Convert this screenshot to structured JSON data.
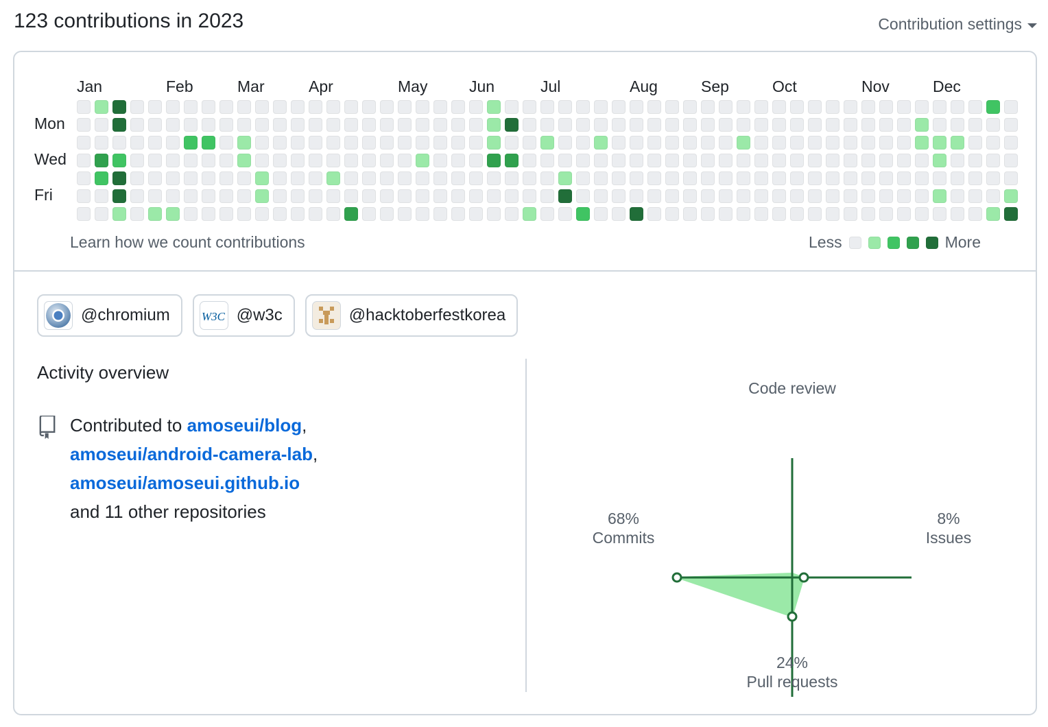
{
  "header": {
    "title": "123 contributions in 2023",
    "settings_label": "Contribution settings"
  },
  "calendar": {
    "months": [
      "Jan",
      "Feb",
      "Mar",
      "Apr",
      "May",
      "Jun",
      "Jul",
      "Aug",
      "Sep",
      "Oct",
      "Nov",
      "Dec"
    ],
    "day_labels": [
      "Mon",
      "Wed",
      "Fri"
    ],
    "learn_link": "Learn how we count contributions",
    "legend_less": "Less",
    "legend_more": "More",
    "colors": [
      "#ebedf0",
      "#9be9a8",
      "#40c463",
      "#30a14e",
      "#216e39"
    ],
    "contribution_levels": {
      "week_1": {
        "Sat": 0
      },
      "week_2": {
        "Sun": 1,
        "Wed": 3,
        "Thu": 2
      },
      "week_3": {
        "Sun": 4,
        "Mon": 4,
        "Wed": 2,
        "Thu": 4,
        "Fri": 4,
        "Sat": 1
      },
      "week_4": {},
      "week_5": {
        "Sat": 1
      },
      "week_6": {
        "Sat": 1
      },
      "week_7": {
        "Tue": 2
      },
      "week_8": {
        "Tue": 2
      },
      "week_10": {
        "Tue": 1,
        "Wed": 1
      },
      "week_11": {
        "Thu": 1,
        "Fri": 1
      },
      "week_15": {
        "Thu": 1
      },
      "week_16": {
        "Sat": 3
      },
      "week_20": {
        "Wed": 1
      },
      "week_24": {
        "Sun": 1,
        "Mon": 1,
        "Tue": 1,
        "Wed": 3
      },
      "week_25": {
        "Mon": 4,
        "Wed": 3
      },
      "week_26": {
        "Sat": 1
      },
      "week_27": {
        "Tue": 1
      },
      "week_28": {
        "Thu": 1,
        "Fri": 4
      },
      "week_29": {
        "Sat": 2
      },
      "week_30": {
        "Tue": 1
      },
      "week_32": {
        "Sat": 4
      },
      "week_38": {
        "Tue": 1
      },
      "week_48": {
        "Mon": 1,
        "Tue": 1
      },
      "week_49": {
        "Tue": 1,
        "Wed": 1,
        "Fri": 1
      },
      "week_50": {
        "Tue": 1
      },
      "week_52": {
        "Sun": 2,
        "Sat": 1
      },
      "week_53": {
        "Fri": 1,
        "Sat": 4
      }
    },
    "weeks": 53
  },
  "orgs": [
    {
      "name": "@chromium",
      "icon": "chromium-logo-icon"
    },
    {
      "name": "@w3c",
      "icon": "w3c-logo-icon",
      "logo_text": "W3C"
    },
    {
      "name": "@hacktoberfestkorea",
      "icon": "hacktoberfestkorea-logo-icon"
    }
  ],
  "activity": {
    "title": "Activity overview",
    "prefix": "Contributed to ",
    "repos": [
      "amoseui/blog",
      "amoseui/android-camera-lab",
      "amoseui/amoseui.github.io"
    ],
    "suffix": "and 11 other repositories"
  },
  "radar": {
    "code_review_label": "Code review",
    "commits_pct": "68%",
    "commits_label": "Commits",
    "issues_pct": "8%",
    "issues_label": "Issues",
    "pr_pct": "24%",
    "pr_label": "Pull requests",
    "values": {
      "commits": 68,
      "issues": 8,
      "pull_requests": 24,
      "code_review": 0
    },
    "line_color": "#216e39",
    "fill_color": "#9be9a8"
  }
}
